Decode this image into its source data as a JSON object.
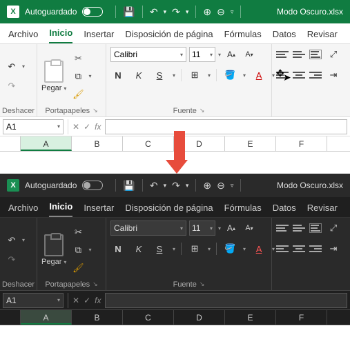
{
  "common": {
    "autosave_label": "Autoguardado",
    "filename": "Modo Oscuro.xlsx",
    "tabs": {
      "archivo": "Archivo",
      "inicio": "Inicio",
      "insertar": "Insertar",
      "disposicion": "Disposición de página",
      "formulas": "Fórmulas",
      "datos": "Datos",
      "revisar": "Revisar"
    },
    "groups": {
      "deshacer": "Deshacer",
      "portapapeles": "Portapapeles",
      "fuente": "Fuente"
    },
    "clipboard": {
      "paste_label": "Pegar"
    },
    "font": {
      "name": "Calibri",
      "size": "11",
      "bold": "N",
      "italic": "K",
      "underline": "S"
    },
    "namebox": "A1",
    "fx_label": "fx",
    "columns": [
      "A",
      "B",
      "C",
      "D",
      "E",
      "F"
    ]
  },
  "qat_icons": {
    "save": "💾",
    "undo": "↶",
    "redo": "↷",
    "zoom_in": "⊕",
    "zoom_out": "⊖",
    "overflow": "⋯",
    "caret": "▾"
  },
  "colors": {
    "accent_light": "#107C41",
    "accent_arrow": "#E74C3C",
    "dark_bg": "#1f1f1f"
  }
}
